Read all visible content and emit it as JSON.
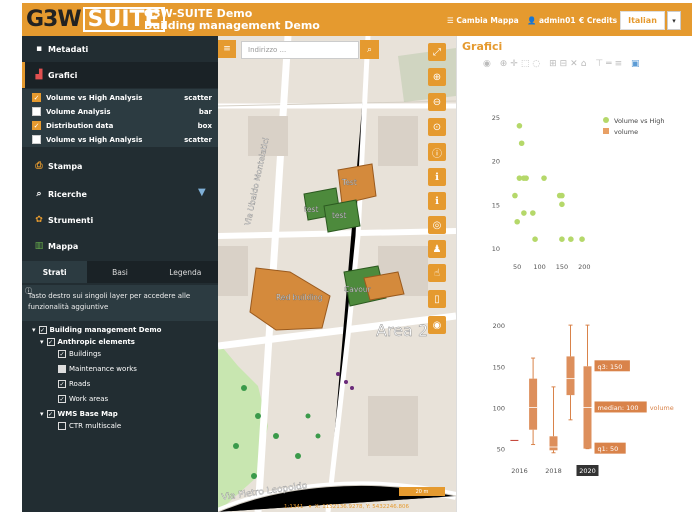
{
  "header": {
    "logo_g3w": "G3W",
    "logo_suite": "SUITE",
    "title": "G3W-SUITE Demo",
    "subtitle": "Building management Demo",
    "links": [
      "Cambia Mappa",
      "admin01",
      "Credits"
    ],
    "language": "Italian"
  },
  "sidebar": {
    "metadata": "Metadati",
    "grafici": "Grafici",
    "charts": [
      {
        "label": "Volume vs High Analysis",
        "type": "scatter",
        "checked": true
      },
      {
        "label": "Volume Analysis",
        "type": "bar",
        "checked": false
      },
      {
        "label": "Distribution data",
        "type": "box",
        "checked": true
      },
      {
        "label": "Volume vs High Analysis",
        "type": "scatter",
        "checked": false
      }
    ],
    "stampa": "Stampa",
    "ricerche": "Ricerche",
    "strumenti": "Strumenti",
    "mappa": "Mappa",
    "tabs": [
      "Strati",
      "Basi",
      "Legenda"
    ],
    "hint": "Tasto destro sui singoli layer per accedere alle funzionalità aggiuntive",
    "tree": {
      "root": "Building management Demo",
      "group1": "Anthropic elements",
      "layers1": [
        "Buildings",
        "Maintenance works",
        "Roads",
        "Work areas"
      ],
      "group2": "WMS Base Map",
      "layers2": [
        "CTR multiscale"
      ]
    }
  },
  "map": {
    "search_placeholder": "Indirizzo ...",
    "labels": [
      "Test",
      "test",
      "test",
      "Red building",
      "Cavour",
      "Area 2",
      "Via Ubaldo Montelatici",
      "Via Pietro Leopoldo"
    ],
    "scale": "20 m",
    "scale_ratio": "1:1341",
    "coords": "X: 1152136.9278, Y: 5432246.806"
  },
  "graphics": {
    "title": "Grafici"
  },
  "chart_data": [
    {
      "type": "scatter",
      "title": "",
      "legend": [
        {
          "name": "Volume vs High",
          "color": "#b5d86a"
        },
        {
          "name": "volume",
          "color": "#e8a065"
        }
      ],
      "xticks": [
        50,
        100,
        150,
        200
      ],
      "yticks": [
        10,
        15,
        20,
        25
      ],
      "xlim": [
        25,
        215
      ],
      "ylim": [
        8.5,
        26.5
      ],
      "series": [
        {
          "name": "Volume vs High",
          "x": [
            45,
            50,
            55,
            55,
            60,
            65,
            65,
            70,
            85,
            90,
            110,
            145,
            150,
            150,
            150,
            170,
            195
          ],
          "y": [
            16,
            13,
            18,
            24,
            22,
            14,
            18,
            18,
            14,
            11,
            18,
            16,
            15,
            11,
            16,
            11,
            11
          ]
        }
      ]
    },
    {
      "type": "box",
      "categories": [
        "2016",
        "2018",
        "2020"
      ],
      "xticks": [
        "2016",
        "2018",
        "2020"
      ],
      "yticks": [
        50,
        100,
        150,
        200
      ],
      "ylim": [
        35,
        205
      ],
      "series_name": "volume",
      "boxes": [
        {
          "x": 2015.7,
          "min": 60,
          "q1": 60,
          "median": 60,
          "q3": 60,
          "max": 60
        },
        {
          "x": 2016.8,
          "min": 55,
          "q1": 73,
          "median": 100,
          "q3": 135,
          "max": 160
        },
        {
          "x": 2018,
          "min": 45,
          "q1": 48,
          "median": 52,
          "q3": 65,
          "max": 125
        },
        {
          "x": 2019,
          "min": 85,
          "q1": 115,
          "median": 135,
          "q3": 162,
          "max": 200
        },
        {
          "x": 2020,
          "min": 50,
          "q1": 50,
          "median": 100,
          "q3": 150,
          "max": 200
        }
      ],
      "annotations": [
        "q3: 150",
        "median: 100",
        "q1: 50"
      ],
      "legend": "volume"
    }
  ]
}
